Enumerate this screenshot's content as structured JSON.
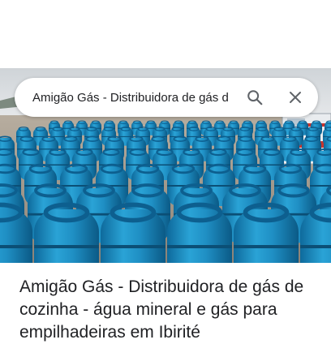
{
  "search": {
    "query": "Amigão Gás - Distribuidora de gás d",
    "search_icon": "search-icon",
    "close_icon": "close-icon"
  },
  "photo": {
    "subject": "gas-cylinders-photo",
    "colors": {
      "sky": "#d9dde0",
      "cylinder": "#1f8fc4",
      "cylinder_dark": "#0f5f8e",
      "ground": "#a39a8c"
    }
  },
  "place": {
    "title": "Amigão Gás - Distribuidora de gás de cozinha - água mineral e gás para empilhadeiras em Ibirité"
  }
}
